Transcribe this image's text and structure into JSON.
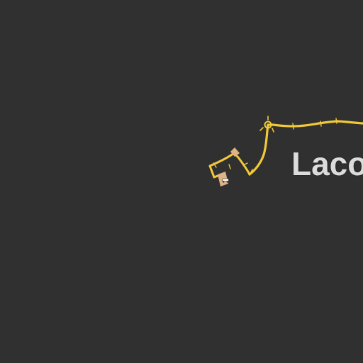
{
  "map": {
    "background_color": "#303030",
    "road_color": "#f2c939",
    "road_outline_color": "#2a2a2a",
    "building_color": "#e0b385",
    "label_color": "#dcdcdc",
    "place_label": "Laco",
    "features": {
      "road": "main-road",
      "roundabout": "roundabout",
      "buildings": [
        "building",
        "building"
      ],
      "poi_icon": "car-icon"
    }
  }
}
